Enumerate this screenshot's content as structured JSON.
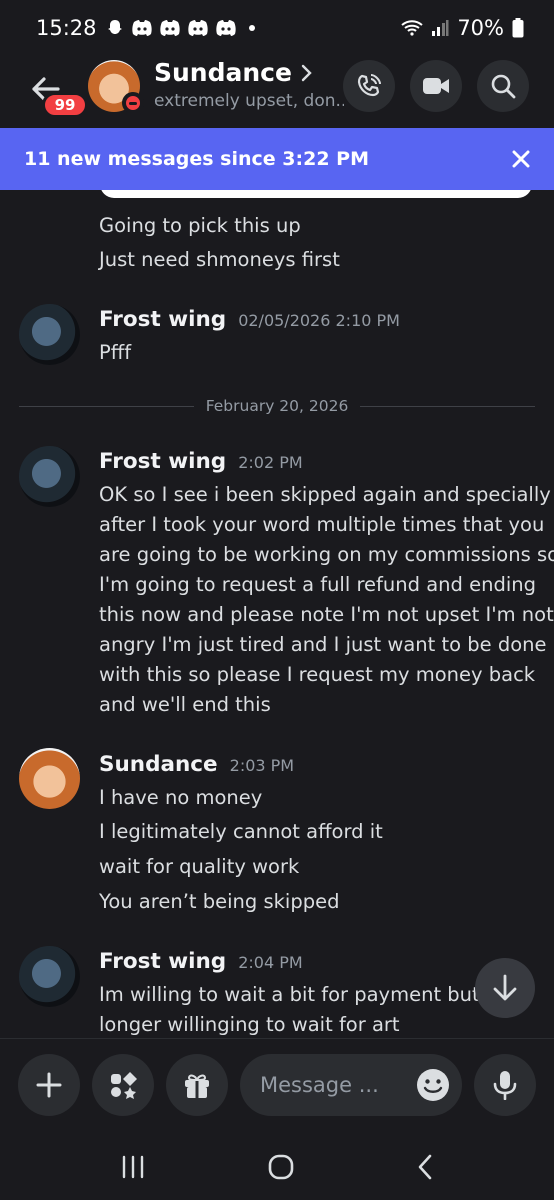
{
  "status_bar": {
    "time": "15:28",
    "battery": "70%",
    "notification_icons": [
      "snapchat-icon",
      "discord-icon",
      "discord-icon",
      "discord-icon",
      "discord-icon"
    ]
  },
  "header": {
    "unread_badge": "99",
    "channel_name": "Sundance",
    "channel_status": "extremely upset, don..."
  },
  "banner": {
    "text": "11 new messages since 3:22 PM"
  },
  "messages": {
    "continuation": [
      "Going to pick this up",
      "Just need shmoneys first"
    ],
    "m1": {
      "author": "Frost wing",
      "time": "02/05/2026 2:10 PM",
      "lines": [
        "Pfff"
      ]
    },
    "date_divider": "February 20, 2026",
    "m2": {
      "author": "Frost wing",
      "time": "2:02 PM",
      "lines": [
        "OK so I see i been skipped again and specially",
        "after I took your word multiple times that you",
        "are going to be working on my commissions so",
        "I'm going to request a full refund and ending",
        "this now and please note I'm not upset I'm not",
        "angry I'm just tired and I just want to be done",
        "with this so please I request my money back",
        "and we'll end this"
      ]
    },
    "m3": {
      "author": "Sundance",
      "time": "2:03 PM",
      "lines": [
        "I have no money",
        "I legitimately cannot afford it",
        "wait for quality work",
        "You aren’t being skipped"
      ]
    },
    "m4": {
      "author": "Frost wing",
      "time": "2:04 PM",
      "lines": [
        "Im willing to wait a bit for payment but I'm",
        "longer willinging to wait for art"
      ]
    }
  },
  "composer": {
    "placeholder": "Message ..."
  },
  "colors": {
    "background": "#1a1a1e",
    "banner": "#5865f2",
    "badge": "#f23f42",
    "button_bg": "#2b2d31"
  }
}
